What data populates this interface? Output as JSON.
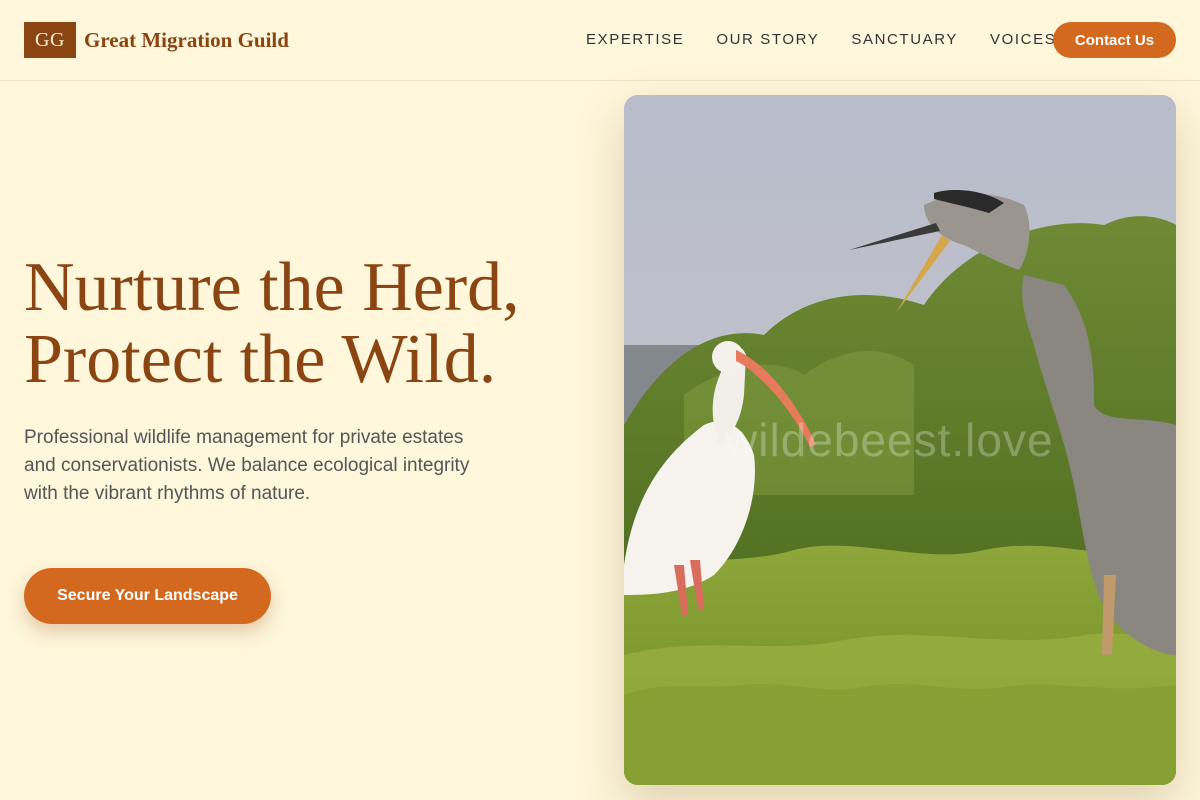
{
  "header": {
    "logo_mark": "GG",
    "brand_name": "Great Migration Guild",
    "nav": [
      {
        "label": "EXPERTISE"
      },
      {
        "label": "OUR STORY"
      },
      {
        "label": "SANCTUARY"
      },
      {
        "label": "VOICES"
      }
    ],
    "contact_label": "Contact Us"
  },
  "hero": {
    "title_line1": "Nurture the Herd,",
    "title_line2": "Protect the Wild.",
    "description": "Professional wildlife management for private estates and conservationists. We balance ecological integrity with the vibrant rhythms of nature.",
    "cta_label": "Secure Your Landscape",
    "image_watermark": "wildebeest.love",
    "image_subject": "ibis-and-heron-photo"
  },
  "colors": {
    "background": "#fef7dc",
    "brand": "#8b4513",
    "accent": "#d2691e"
  }
}
